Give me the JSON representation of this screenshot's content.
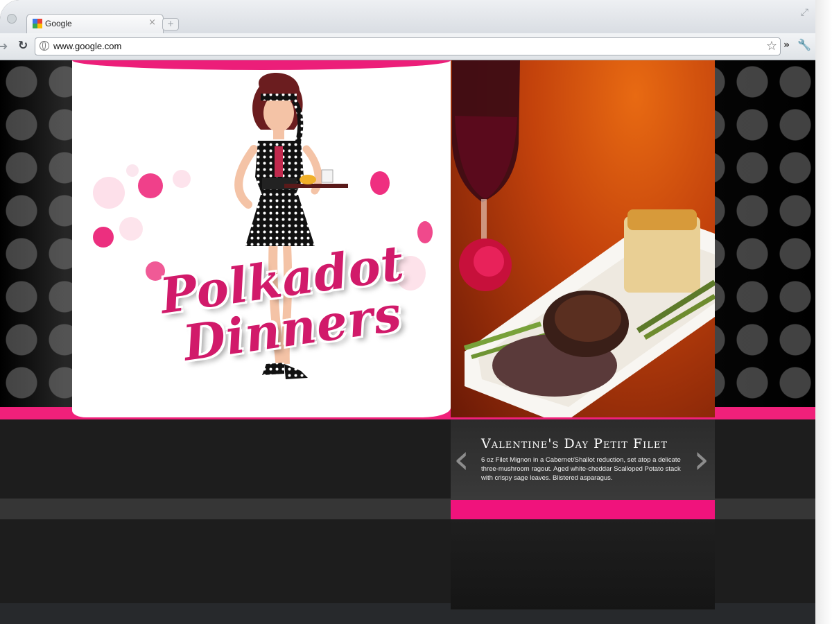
{
  "browser": {
    "tab_title": "Google",
    "tab_close": "×",
    "new_tab": "+",
    "url": "www.google.com",
    "icons": [
      "back-icon",
      "reload-icon",
      "globe-icon",
      "star-icon",
      "more-icon",
      "wrench-icon",
      "close-icon",
      "new-tab-icon",
      "google-favicon"
    ]
  },
  "logo": {
    "line1": "Polkadot",
    "line2": "Dinners"
  },
  "feature": {
    "title": "Valentine's Day Petit Filet",
    "description": "6 oz Filet Mignon in a Cabernet/Shallot reduction, set atop a delicate three-mushroom ragout. Aged white-cheddar Scalloped Potato stack with crispy sage leaves. Blistered asparagus.",
    "prev_arrow": "‹",
    "next_arrow": "›"
  },
  "colors": {
    "brand_pink": "#f0207a",
    "dark_bg": "#161616"
  }
}
